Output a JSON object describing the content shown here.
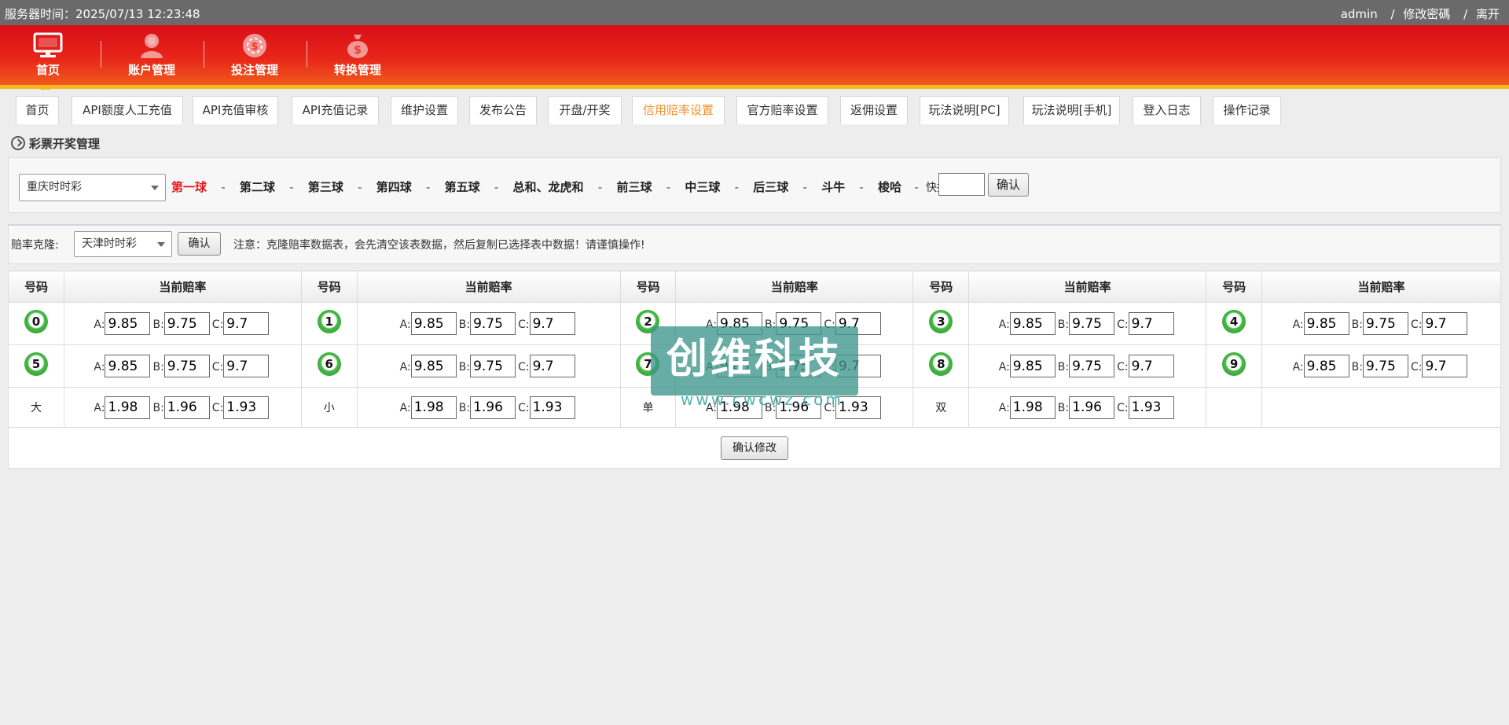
{
  "topbar": {
    "server_time": "服务器时间：2025/07/13 12:23:48",
    "user": "admin",
    "sep1": "/",
    "change_password": "修改密碼",
    "sep2": "/",
    "logout": "离开"
  },
  "nav": [
    {
      "label": "首页",
      "icon": "monitor-icon"
    },
    {
      "label": "账户管理",
      "icon": "user-icon"
    },
    {
      "label": "投注管理",
      "icon": "chip-icon"
    },
    {
      "label": "转换管理",
      "icon": "money-bag-icon"
    }
  ],
  "tabs": [
    "首页",
    "API额度人工充值",
    "API充值审核",
    "API充值记录",
    "维护设置",
    "发布公告",
    "开盘/开奖",
    "信用赔率设置",
    "官方赔率设置",
    "返佣设置",
    "玩法说明[PC]",
    "玩法说明[手机]",
    "登入日志",
    "操作记录"
  ],
  "active_tab": "信用赔率设置",
  "section_title": "彩票开奖管理",
  "filter": {
    "lottery_select": "重庆时时彩",
    "balls": [
      "第一球",
      "第二球",
      "第三球",
      "第四球",
      "第五球",
      "总和、龙虎和",
      "前三球",
      "中三球",
      "后三球",
      "斗牛",
      "梭哈"
    ],
    "separator": "-",
    "quick_set_label": "快捷设置:",
    "quick_set_value": "",
    "confirm": "确认"
  },
  "clone": {
    "label": "赔率克隆:",
    "select": "天津时时彩",
    "confirm": "确认",
    "notice": "注意：克隆赔率数据表，会先清空该表数据，然后复制已选择表中数据！请谨慎操作!"
  },
  "table": {
    "col_number": "号码",
    "col_odds": "当前赔率",
    "rows": [
      [
        {
          "num": "0",
          "ball": true,
          "a": "9.85",
          "b": "9.75",
          "c": "9.7"
        },
        {
          "num": "1",
          "ball": true,
          "a": "9.85",
          "b": "9.75",
          "c": "9.7"
        },
        {
          "num": "2",
          "ball": true,
          "a": "9.85",
          "b": "9.75",
          "c": "9.7"
        },
        {
          "num": "3",
          "ball": true,
          "a": "9.85",
          "b": "9.75",
          "c": "9.7"
        },
        {
          "num": "4",
          "ball": true,
          "a": "9.85",
          "b": "9.75",
          "c": "9.7"
        }
      ],
      [
        {
          "num": "5",
          "ball": true,
          "a": "9.85",
          "b": "9.75",
          "c": "9.7"
        },
        {
          "num": "6",
          "ball": true,
          "a": "9.85",
          "b": "9.75",
          "c": "9.7"
        },
        {
          "num": "7",
          "ball": true,
          "a": "9.85",
          "b": "9.75",
          "c": "9.7"
        },
        {
          "num": "8",
          "ball": true,
          "a": "9.85",
          "b": "9.75",
          "c": "9.7"
        },
        {
          "num": "9",
          "ball": true,
          "a": "9.85",
          "b": "9.75",
          "c": "9.7"
        }
      ],
      [
        {
          "num": "大",
          "ball": false,
          "a": "1.98",
          "b": "1.96",
          "c": "1.93"
        },
        {
          "num": "小",
          "ball": false,
          "a": "1.98",
          "b": "1.96",
          "c": "1.93"
        },
        {
          "num": "单",
          "ball": false,
          "a": "1.98",
          "b": "1.96",
          "c": "1.93"
        },
        {
          "num": "双",
          "ball": false,
          "a": "1.98",
          "b": "1.96",
          "c": "1.93"
        },
        null
      ]
    ],
    "label_a": "A:",
    "label_b": "B:",
    "label_c": "C:",
    "submit": "确认修改"
  },
  "watermark": {
    "text": "创维科技",
    "url": "www.cwcwz.com"
  }
}
